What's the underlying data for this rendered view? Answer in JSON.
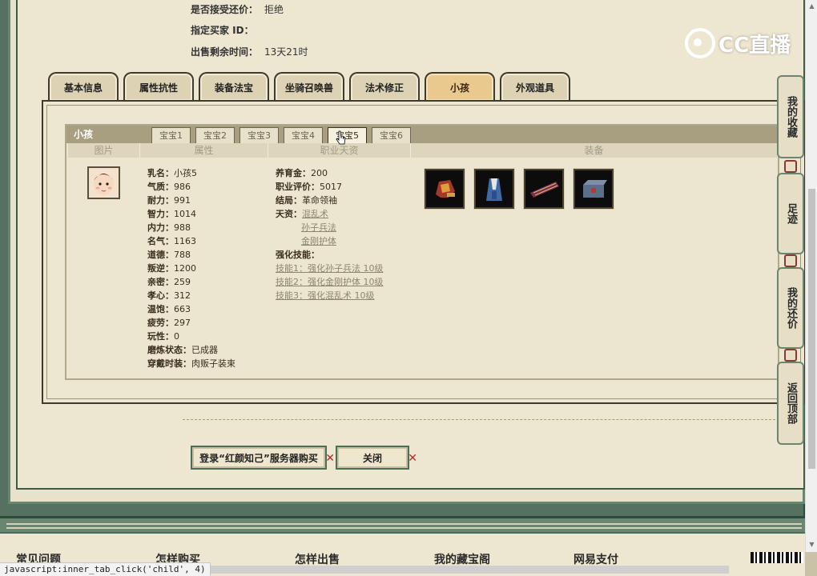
{
  "info": [
    {
      "label": "是否接受还价：",
      "value": "拒绝"
    },
    {
      "label": "指定买家 ID：",
      "value": ""
    },
    {
      "label": "出售剩余时间：",
      "value": "13天21时"
    }
  ],
  "logo_text": "CC直播",
  "main_tabs": [
    "基本信息",
    "属性抗性",
    "装备法宝",
    "坐骑召唤兽",
    "法术修正",
    "小孩",
    "外观道具"
  ],
  "active_main_tab": "小孩",
  "child": {
    "title": "小孩",
    "sub_tabs": [
      "宝宝1",
      "宝宝2",
      "宝宝3",
      "宝宝4",
      "宝宝5",
      "宝宝6"
    ],
    "columns": [
      "图片",
      "属性",
      "职业天资",
      "装备"
    ],
    "attributes": [
      {
        "k": "乳名：",
        "v": "小孩5"
      },
      {
        "k": "气质：",
        "v": "986"
      },
      {
        "k": "耐力：",
        "v": "991"
      },
      {
        "k": "智力：",
        "v": "1014"
      },
      {
        "k": "内力：",
        "v": "988"
      },
      {
        "k": "名气：",
        "v": "1163"
      },
      {
        "k": "道德：",
        "v": "788"
      },
      {
        "k": "叛逆：",
        "v": "1200"
      },
      {
        "k": "亲密：",
        "v": "259"
      },
      {
        "k": "孝心：",
        "v": "312"
      },
      {
        "k": "温饱：",
        "v": "663"
      },
      {
        "k": "疲劳：",
        "v": "297"
      },
      {
        "k": "玩性：",
        "v": "0"
      },
      {
        "k": "磨炼状态：",
        "v": "已成器"
      },
      {
        "k": "穿戴时装：",
        "v": "肉贩子装束"
      }
    ],
    "career": {
      "fund_label": "养育金：",
      "fund": "200",
      "rating_label": "职业评价：",
      "rating": "5017",
      "ending_label": "结局：",
      "ending": "革命领袖",
      "talent_label": "天资：",
      "talents": [
        "混乱术",
        "孙子兵法",
        "金刚护体"
      ],
      "skills_label": "强化技能：",
      "skills": [
        "技能1：强化孙子兵法 10级",
        "技能2：强化金刚护体 10级",
        "技能3：强化混乱术 10级"
      ]
    },
    "equipment": [
      "equip-slot-1",
      "equip-slot-2",
      "equip-slot-3",
      "equip-slot-4"
    ]
  },
  "buttons": {
    "login_buy": "登录“红颜知己”服务器购买",
    "close": "关闭"
  },
  "side_bar": [
    "我的收藏",
    "足迹",
    "我的还价",
    "返回顶部"
  ],
  "footer_links": [
    "常见问题",
    "怎样购买",
    "怎样出售",
    "我的藏宝阁",
    "网易支付"
  ],
  "status_text": "javascript:inner_tab_click('child', 4)",
  "colors": {
    "accent_tab": "#e9c98e",
    "frame_green": "#557260",
    "paper": "#ede6d0",
    "knot_red": "#b52a25"
  }
}
